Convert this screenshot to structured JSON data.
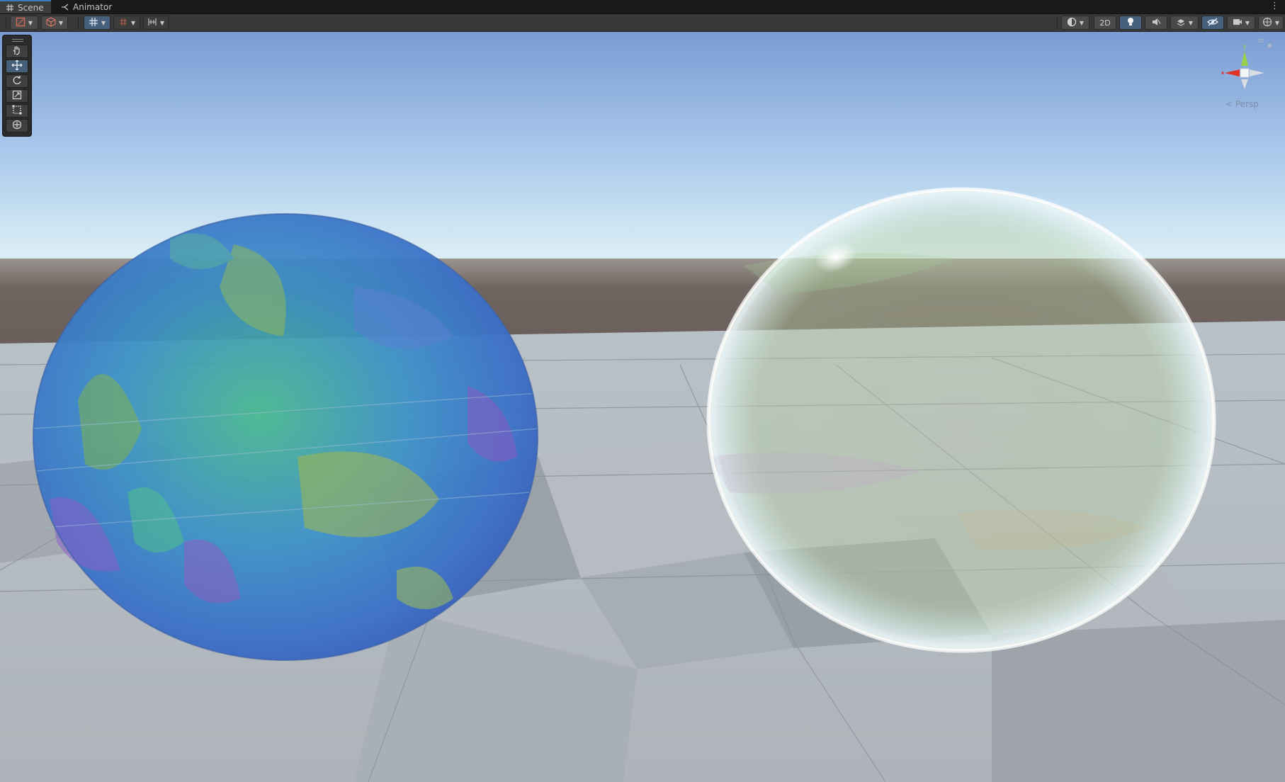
{
  "tabs": [
    {
      "label": "Scene",
      "icon": "grid-icon",
      "active": true
    },
    {
      "label": "Animator",
      "icon": "animator-icon",
      "active": false
    }
  ],
  "tab_menu_glyph": "⋮",
  "toolbar": {
    "view_2d_label": "2D",
    "accent_color": "#46607c"
  },
  "tools": [
    {
      "name": "hand-tool",
      "icon": "hand-icon",
      "selected": false
    },
    {
      "name": "move-tool",
      "icon": "move-arrows-icon",
      "selected": true
    },
    {
      "name": "rotate-tool",
      "icon": "rotate-icon",
      "selected": false
    },
    {
      "name": "scale-tool",
      "icon": "scale-icon",
      "selected": false
    },
    {
      "name": "rect-tool",
      "icon": "rect-transform-icon",
      "selected": false
    },
    {
      "name": "transform-tool",
      "icon": "transform-icon",
      "selected": false
    }
  ],
  "gizmo": {
    "projection_label": "< Persp",
    "axis_y_label": "y",
    "axis_x_color": "#e0332a",
    "axis_y_color": "#9bd04a",
    "axis_z_color": "#4a7fd0"
  },
  "scene": {
    "sky_top": "#7b9fd6",
    "horizon": "#d9ecf3",
    "ground": "#6d6360",
    "floor_light": "#c8ccd1",
    "floor_dark": "#9aa0a7",
    "left_sphere_colors": [
      "#2f7fd0",
      "#3fb08a",
      "#7a5bc8"
    ],
    "right_sphere_tint": "#e8f6ff"
  }
}
